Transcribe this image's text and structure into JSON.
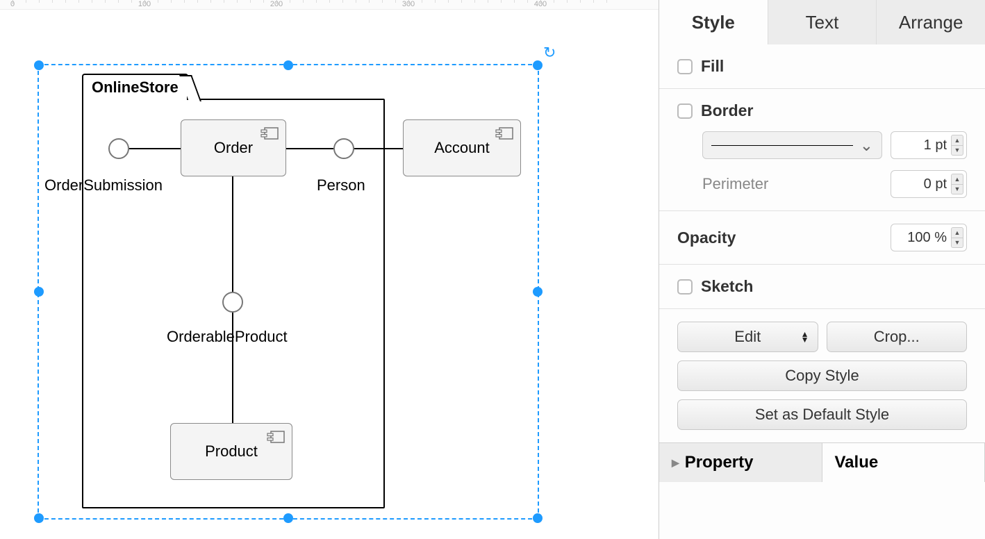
{
  "canvas": {
    "ruler_ticks": [
      0,
      100,
      200,
      300,
      400
    ],
    "package_title": "OnlineStore",
    "order_label": "Order",
    "account_label": "Account",
    "product_label": "Product",
    "port_submission": "OrderSubmission",
    "port_person": "Person",
    "port_orderable": "OrderableProduct"
  },
  "sidebar": {
    "tabs": {
      "style": "Style",
      "text": "Text",
      "arrange": "Arrange"
    },
    "fill_label": "Fill",
    "border_label": "Border",
    "border_width": "1 pt",
    "perimeter_label": "Perimeter",
    "perimeter_value": "0 pt",
    "opacity_label": "Opacity",
    "opacity_value": "100 %",
    "sketch_label": "Sketch",
    "edit_label": "Edit",
    "crop_label": "Crop...",
    "copy_style": "Copy Style",
    "default_style": "Set as Default Style",
    "property_col": "Property",
    "value_col": "Value"
  }
}
